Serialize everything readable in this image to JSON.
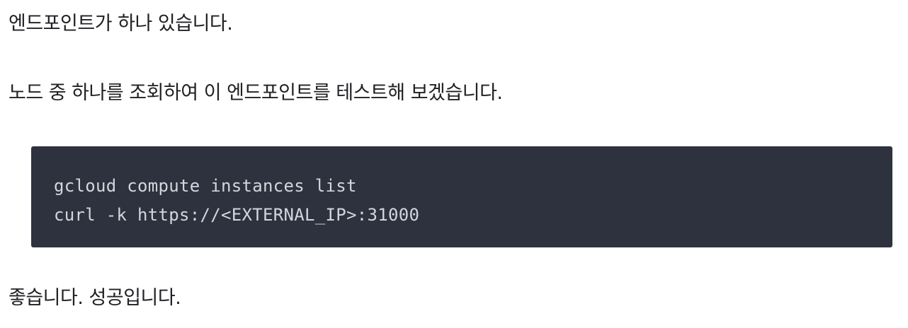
{
  "paragraphs": {
    "p1": "엔드포인트가 하나 있습니다.",
    "p2": "노드 중 하나를 조회하여 이 엔드포인트를 테스트해 보겠습니다.",
    "p3": "좋습니다. 성공입니다."
  },
  "code": {
    "lines": [
      "gcloud compute instances list",
      "curl -k https://<EXTERNAL_IP>:31000"
    ]
  },
  "colors": {
    "text": "#202124",
    "code_background": "#2d323e",
    "code_text": "#d4d6dc"
  }
}
